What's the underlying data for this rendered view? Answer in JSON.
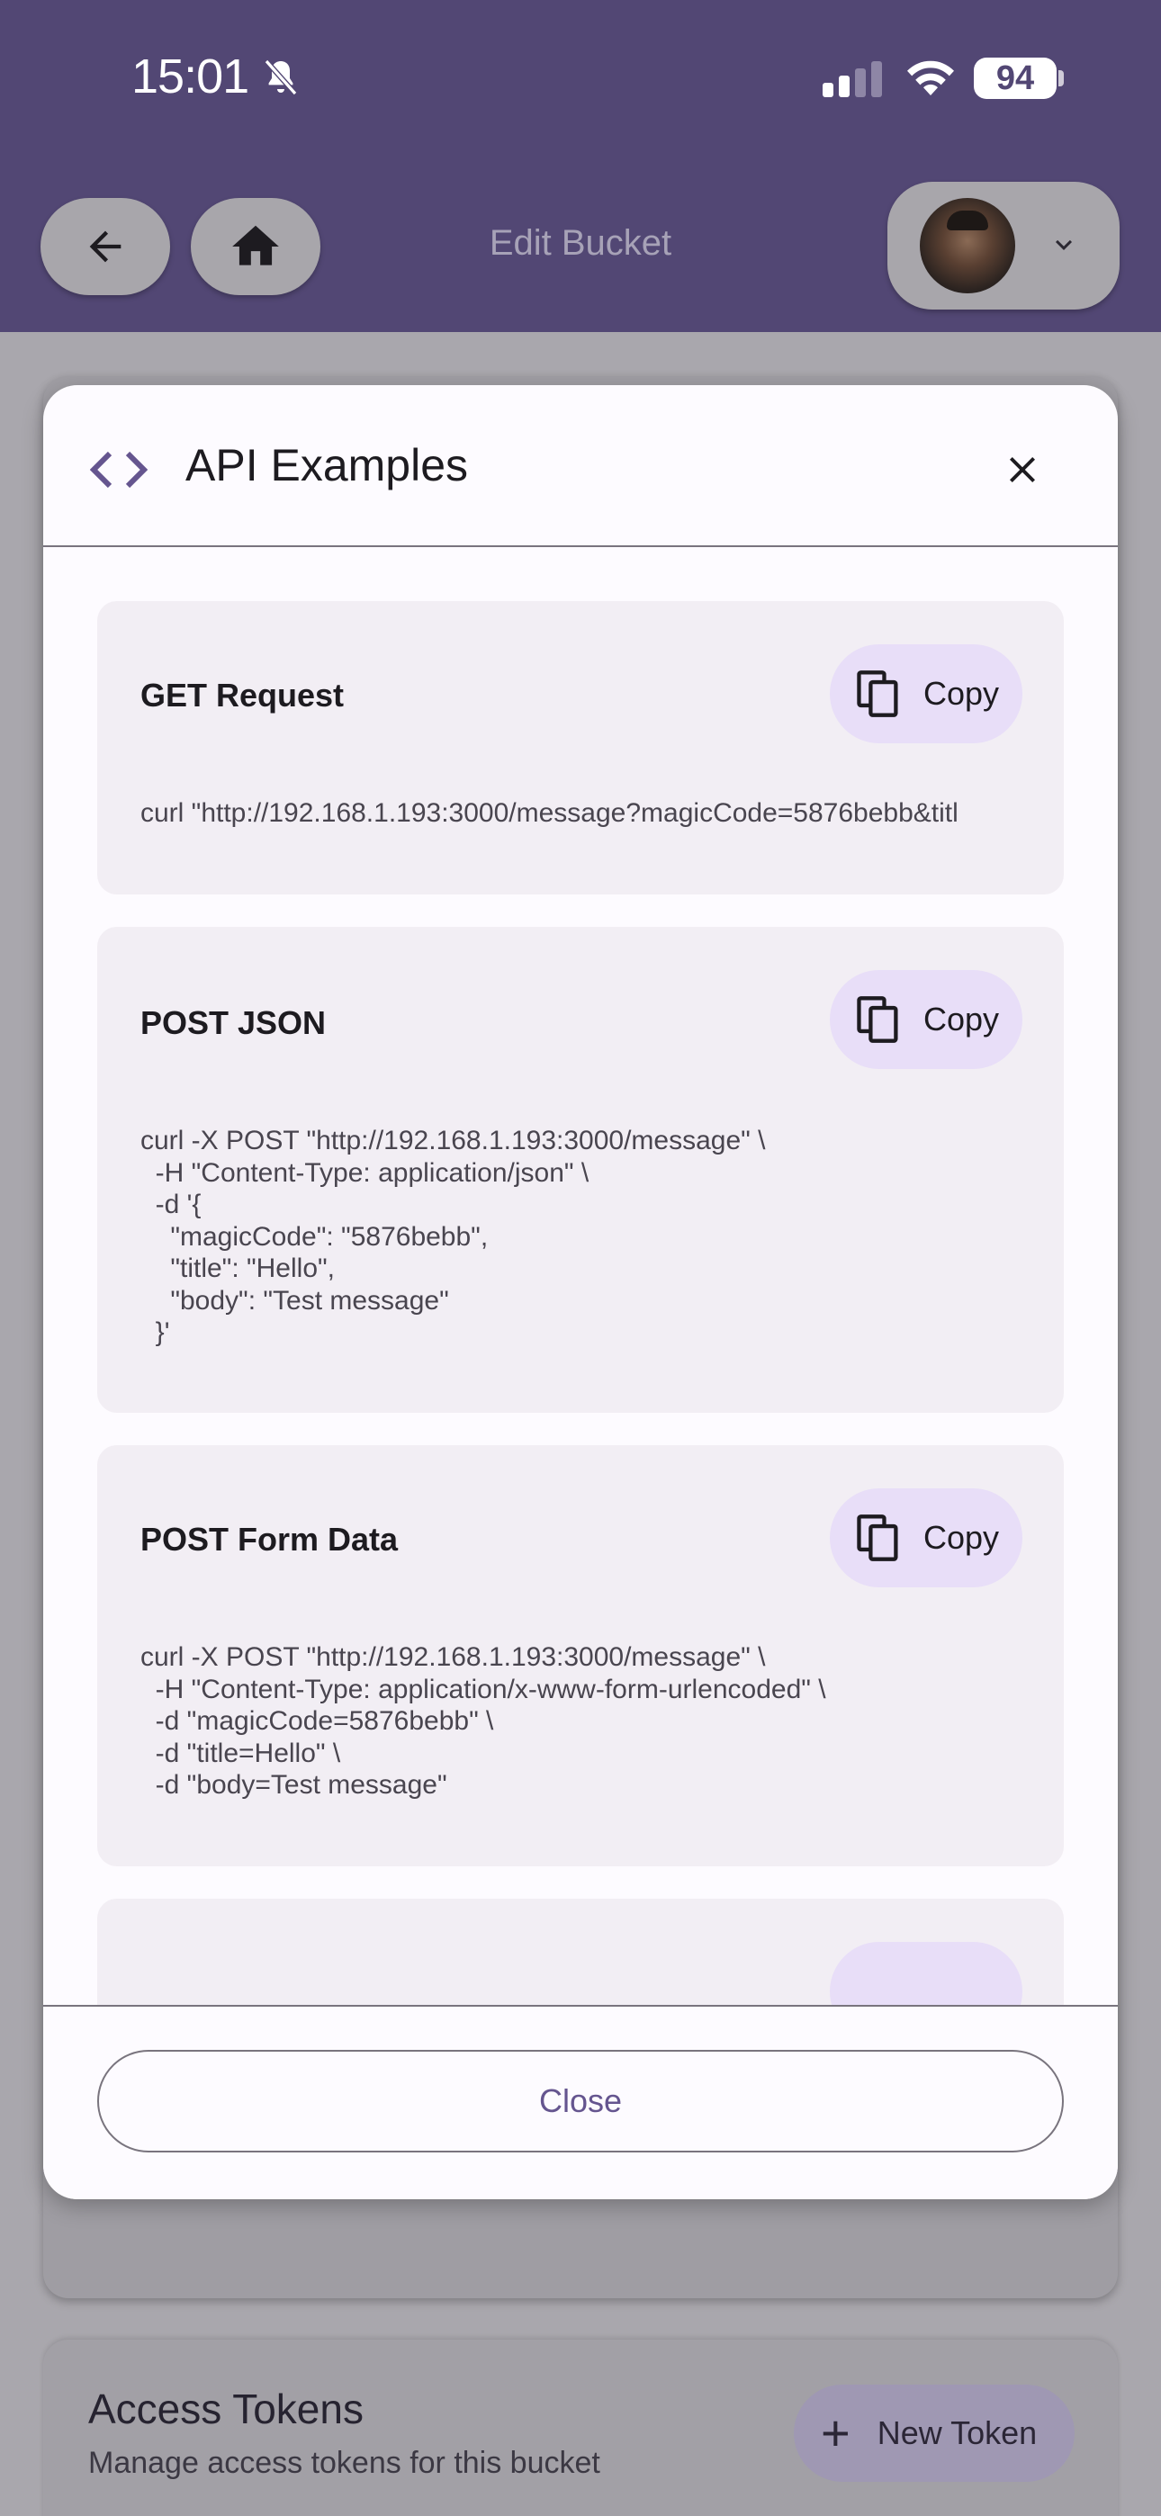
{
  "status_bar": {
    "time": "15:01",
    "battery": "94"
  },
  "app_bar": {
    "title": "Edit Bucket"
  },
  "background": {
    "access_tokens": {
      "title": "Access Tokens",
      "subtitle": "Manage access tokens for this bucket",
      "new_token_label": "New Token"
    }
  },
  "dialog": {
    "title": "API Examples",
    "close_label": "Close",
    "examples": [
      {
        "title": "GET Request",
        "copy_label": "Copy",
        "code": "curl \"http://192.168.1.193:3000/message?magicCode=5876bebb&titl"
      },
      {
        "title": "POST JSON",
        "copy_label": "Copy",
        "code": "curl -X POST \"http://192.168.1.193:3000/message\" \\\n  -H \"Content-Type: application/json\" \\\n  -d '{\n    \"magicCode\": \"5876bebb\",\n    \"title\": \"Hello\",\n    \"body\": \"Test message\"\n  }'"
      },
      {
        "title": "POST Form Data",
        "copy_label": "Copy",
        "code": "curl -X POST \"http://192.168.1.193:3000/message\" \\\n  -H \"Content-Type: application/x-www-form-urlencoded\" \\\n  -d \"magicCode=5876bebb\" \\\n  -d \"title=Hello\" \\\n  -d \"body=Test message\""
      }
    ]
  },
  "colors": {
    "app_bar": "#524774",
    "accent": "#65558f",
    "copy_button": "#e8def8",
    "card": "#f2eef4",
    "scrim": "#a9a7ad"
  },
  "icons": {
    "back": "arrow-back-icon",
    "home": "home-icon",
    "profile_menu": "chevron-down-icon",
    "dialog": "code-icon",
    "close": "close-icon",
    "copy": "copy-icon",
    "add": "plus-icon",
    "silent": "bell-off-icon",
    "signal": "cellular-signal-icon",
    "wifi": "wifi-icon"
  }
}
